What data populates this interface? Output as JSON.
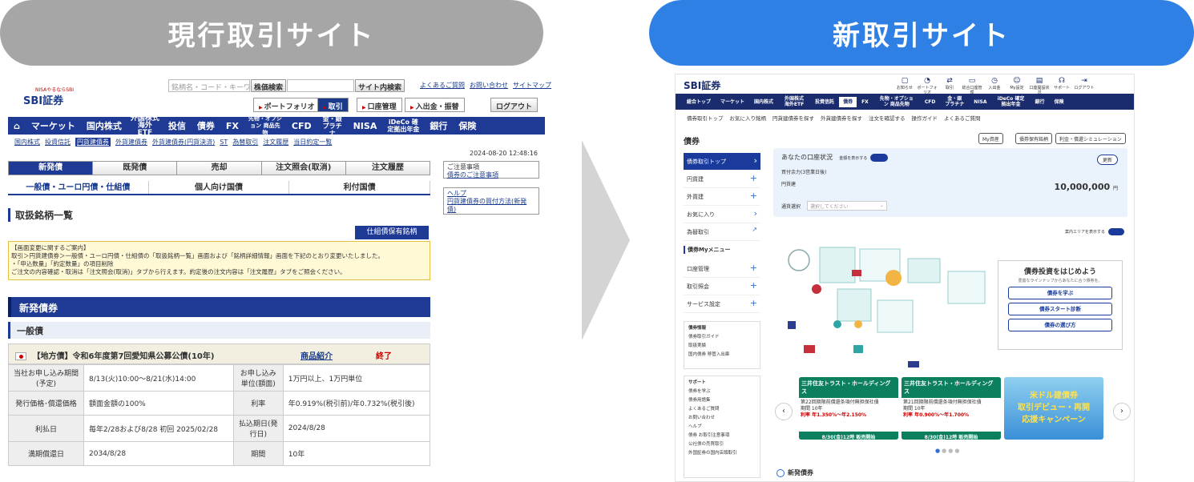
{
  "headers": {
    "old": "現行取引サイト",
    "new": "新取引サイト"
  },
  "old": {
    "logo": {
      "tag": "NISAやるならSBI",
      "name": "SBI証券"
    },
    "search": {
      "placeholder": "銘柄名・コード・キーワ",
      "btn1": "株価検索",
      "btn2": "サイト内検索"
    },
    "toplinks": [
      "よくあるご質問",
      "お問い合わせ",
      "サイトマップ"
    ],
    "tabs": [
      "ポートフォリオ",
      "取引",
      "口座管理",
      "入出金・振替"
    ],
    "logout": "ログアウト",
    "gnav": [
      "マーケット",
      "国内株式",
      "外国株式 海外ETF",
      "投信",
      "債券",
      "FX",
      "先物・オプション 商品先物",
      "CFD",
      "金・銀 プラチナ",
      "NISA",
      "iDeCo 確定拠出年金",
      "銀行",
      "保険"
    ],
    "subnav": [
      "国内株式",
      "投資信託",
      "円貨建債券",
      "外貨建債券",
      "外貨建債券(円貨決済)",
      "ST",
      "為替取引",
      "注文履歴",
      "当日約定一覧"
    ],
    "timestamp": "2024-08-20 12:48:16",
    "tabs1": [
      "新発債",
      "既発債",
      "売却",
      "注文照会(取消)",
      "注文履歴"
    ],
    "tabs2": [
      "一般債・ユーロ円債・仕組債",
      "個人向け国債",
      "利付国債"
    ],
    "sidebox1": {
      "title": "ご注意事項",
      "link": "債券のご注意事項"
    },
    "sidebox2": {
      "title": "ヘルプ",
      "link": "円貨建債券の買付方法(新発債)"
    },
    "heading": "取扱銘柄一覧",
    "hold_btn": "仕組債保有銘柄",
    "notice": [
      "【画面変更に関するご案内】",
      "取引＞円貨建債券＞一般債・ユーロ円債・仕組債の「取扱銘柄一覧」画面および「銘柄詳細情報」画面を下記のとおり変更いたしました。",
      "・「申込数量」「約定数量」の項目削除",
      "ご注文の内容確認・取消は「注文照会(取消)」タブから行えます。約定後の注文内容は「注文履歴」タブをご照会ください。"
    ],
    "bar1": "新発債券",
    "bar2": "一般債",
    "bond": {
      "name": "【地方債】令和6年度第7回愛知県公募公債(10年)",
      "link": "商品紹介",
      "status": "終了"
    },
    "table": [
      [
        "当社お申し込み期間(予定)",
        "8/13(火)10:00〜8/21(水)14:00",
        "お申し込み単位(額面)",
        "1万円以上、1万円単位"
      ],
      [
        "発行価格･償還価格",
        "額面金額の100%",
        "利率",
        "年0.919%(税引前)/年0.732%(税引後)"
      ],
      [
        "利払日",
        "毎年2/28および8/28 初回 2025/02/28",
        "払込期日(発行日)",
        "2024/8/28"
      ],
      [
        "満期償還日",
        "2034/8/28",
        "期間",
        "10年"
      ]
    ]
  },
  "new": {
    "logo": "SBI証券",
    "icons": [
      "お知らせ",
      "ポートフォリオ",
      "取引",
      "総合口座管理",
      "入出金",
      "My設定",
      "口座開設状況",
      "サポート",
      "ログアウト"
    ],
    "nav": [
      "総合トップ",
      "マーケット",
      "国内株式",
      "外国株式 海外ETF",
      "投資信託",
      "債券",
      "FX",
      "先物・オプション 商品先物",
      "CFD",
      "金・銀 プラチナ",
      "NISA",
      "iDeCo 確定拠出年金",
      "銀行",
      "保険"
    ],
    "subnav": [
      "債券取引トップ",
      "お気に入り銘柄",
      "円貨建債券を探す",
      "外貨建債券を探す",
      "注文を確認する",
      "操作ガイド",
      "よくあるご質問"
    ],
    "title": "債券",
    "buttons": [
      "My資産",
      "債券保有銘柄",
      "利金・償還シミュレーション"
    ],
    "side": [
      "債券取引トップ",
      "円貨建",
      "外貨建",
      "お気に入り",
      "為替取引"
    ],
    "my_menu": "債券Myメニュー",
    "side2": [
      "口座管理",
      "取引照会",
      "サービス設定"
    ],
    "info": {
      "title": "債券情報",
      "links": [
        "債券取引ガイド",
        "取扱実績",
        "国内債券 移管入出庫"
      ]
    },
    "support": {
      "title": "サポート",
      "links": [
        "債券を学ぶ",
        "債券用語集",
        "よくあるご質問",
        "お問い合わせ",
        "ヘルプ",
        "債券 お取引注意事項",
        "公社債の売買取引",
        "外国証券の国内店頭取引"
      ]
    },
    "account": {
      "title": "あなたの口座状況",
      "toggle": "金額を表示する",
      "buying_power": "買付余力(3営業日後)",
      "currency": "円貨建",
      "amount": "10,000,000",
      "unit": "円",
      "select_label": "通貨選択",
      "select_placeholder": "選択してください",
      "refresh": "更新"
    },
    "area_toggle": "案内エリアを表示する",
    "learn": {
      "title": "債券投資をはじめよう",
      "sub": "豊富なラインナップからあなたに合う債券を。",
      "btns": [
        "債券を学ぶ",
        "債券スタート診断",
        "債券の選び方"
      ]
    },
    "banners": [
      {
        "head": "三井住友トラスト・ホールディングス",
        "sub": "第22回期限前償還条項付無担保社債",
        "term": "期間 10年",
        "rate": "利率 年1.350%〜年2.150%",
        "foot": "8/30(金)12時 販売開始"
      },
      {
        "head": "三井住友トラスト・ホールディングス",
        "sub": "第21回期限前償還条項付無担保社債",
        "term": "期間 10年",
        "rate": "利率 年0.900%〜年1.700%",
        "foot": "8/30(金)12時 販売開始"
      },
      {
        "head": "米ドル建債券",
        "sub": "取引デビュー・再開",
        "term": "応援キャンペーン",
        "rate": "",
        "foot": ""
      }
    ],
    "new_bonds": "新発債券"
  }
}
